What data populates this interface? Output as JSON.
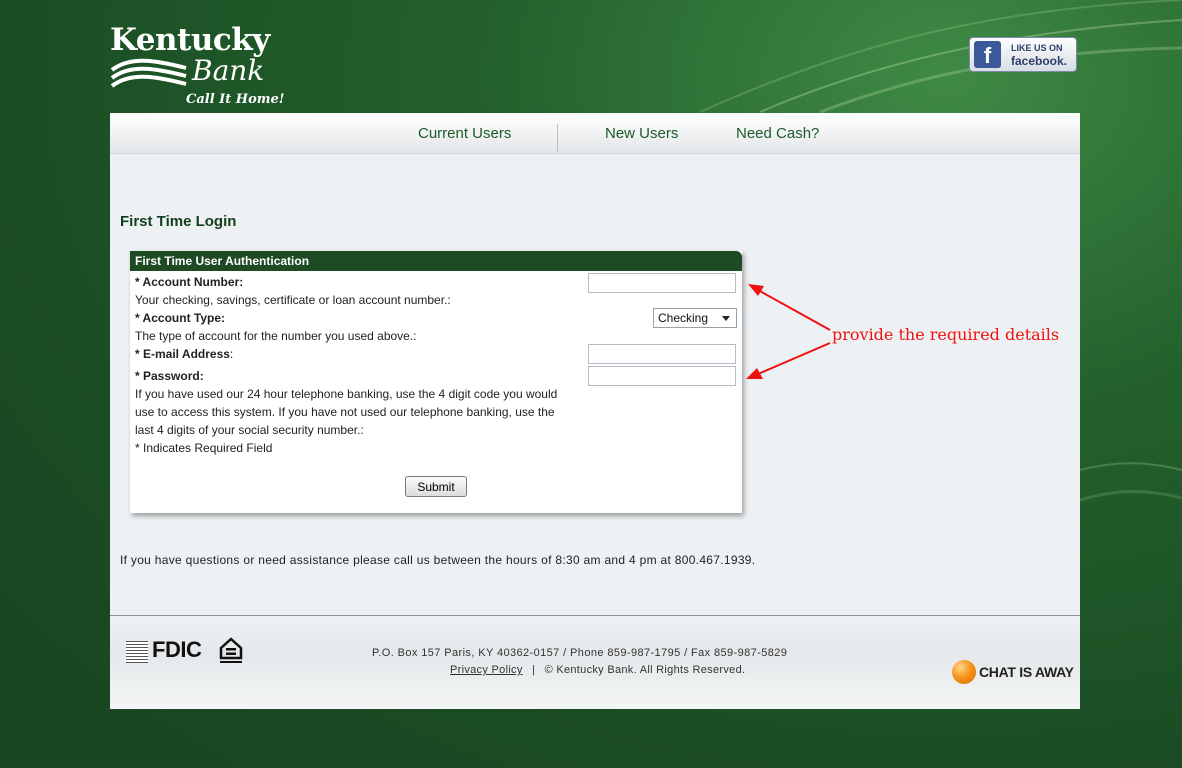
{
  "brand": {
    "name_line1": "Kentucky",
    "name_line2": "Bank",
    "tagline": "Call It Home!"
  },
  "facebook": {
    "line1": "LIKE US ON",
    "line2": "facebook.",
    "icon": "facebook-f-icon",
    "color": "#3b5998"
  },
  "nav": {
    "items": [
      {
        "label": "Current Users"
      },
      {
        "label": "New Users"
      },
      {
        "label": "Need Cash?"
      }
    ]
  },
  "page": {
    "title": "First Time Login"
  },
  "form": {
    "header": "First Time User Authentication",
    "fields": {
      "account_number": {
        "label": "* Account Number:",
        "help": "Your checking, savings, certificate or loan account number.:",
        "value": ""
      },
      "account_type": {
        "label": "* Account Type:",
        "help": "The type of account for the number you used above.:",
        "value": "Checking"
      },
      "email": {
        "label": "* E-mail Address",
        "suffix": ":",
        "value": ""
      },
      "password": {
        "label": "* Password:",
        "help_line1": "If you have used our 24 hour telephone banking, use the 4 digit code you would",
        "help_line2": "use to access this system. If you have not used our telephone banking, use the",
        "help_line3": "last 4 digits of your social security number.:",
        "value": ""
      }
    },
    "required_note": "* Indicates Required Field",
    "submit_label": "Submit"
  },
  "help_text": "If you have questions or need assistance please call us between the hours of 8:30 am and 4 pm at 800.467.1939.",
  "footer": {
    "fdic": "FDIC",
    "address": "P.O. Box 157 Paris, KY 40362-0157  /  Phone 859-987-1795  /  Fax 859-987-5829",
    "privacy_label": "Privacy Policy",
    "separator": "|",
    "copyright": "© Kentucky Bank. All Rights Reserved.",
    "chat_label": "CHAT IS AWAY"
  },
  "annotation": {
    "text": "provide the required details",
    "color": "#e11111"
  },
  "colors": {
    "brand_green": "#1e4a24",
    "nav_text": "#1c5a27"
  }
}
